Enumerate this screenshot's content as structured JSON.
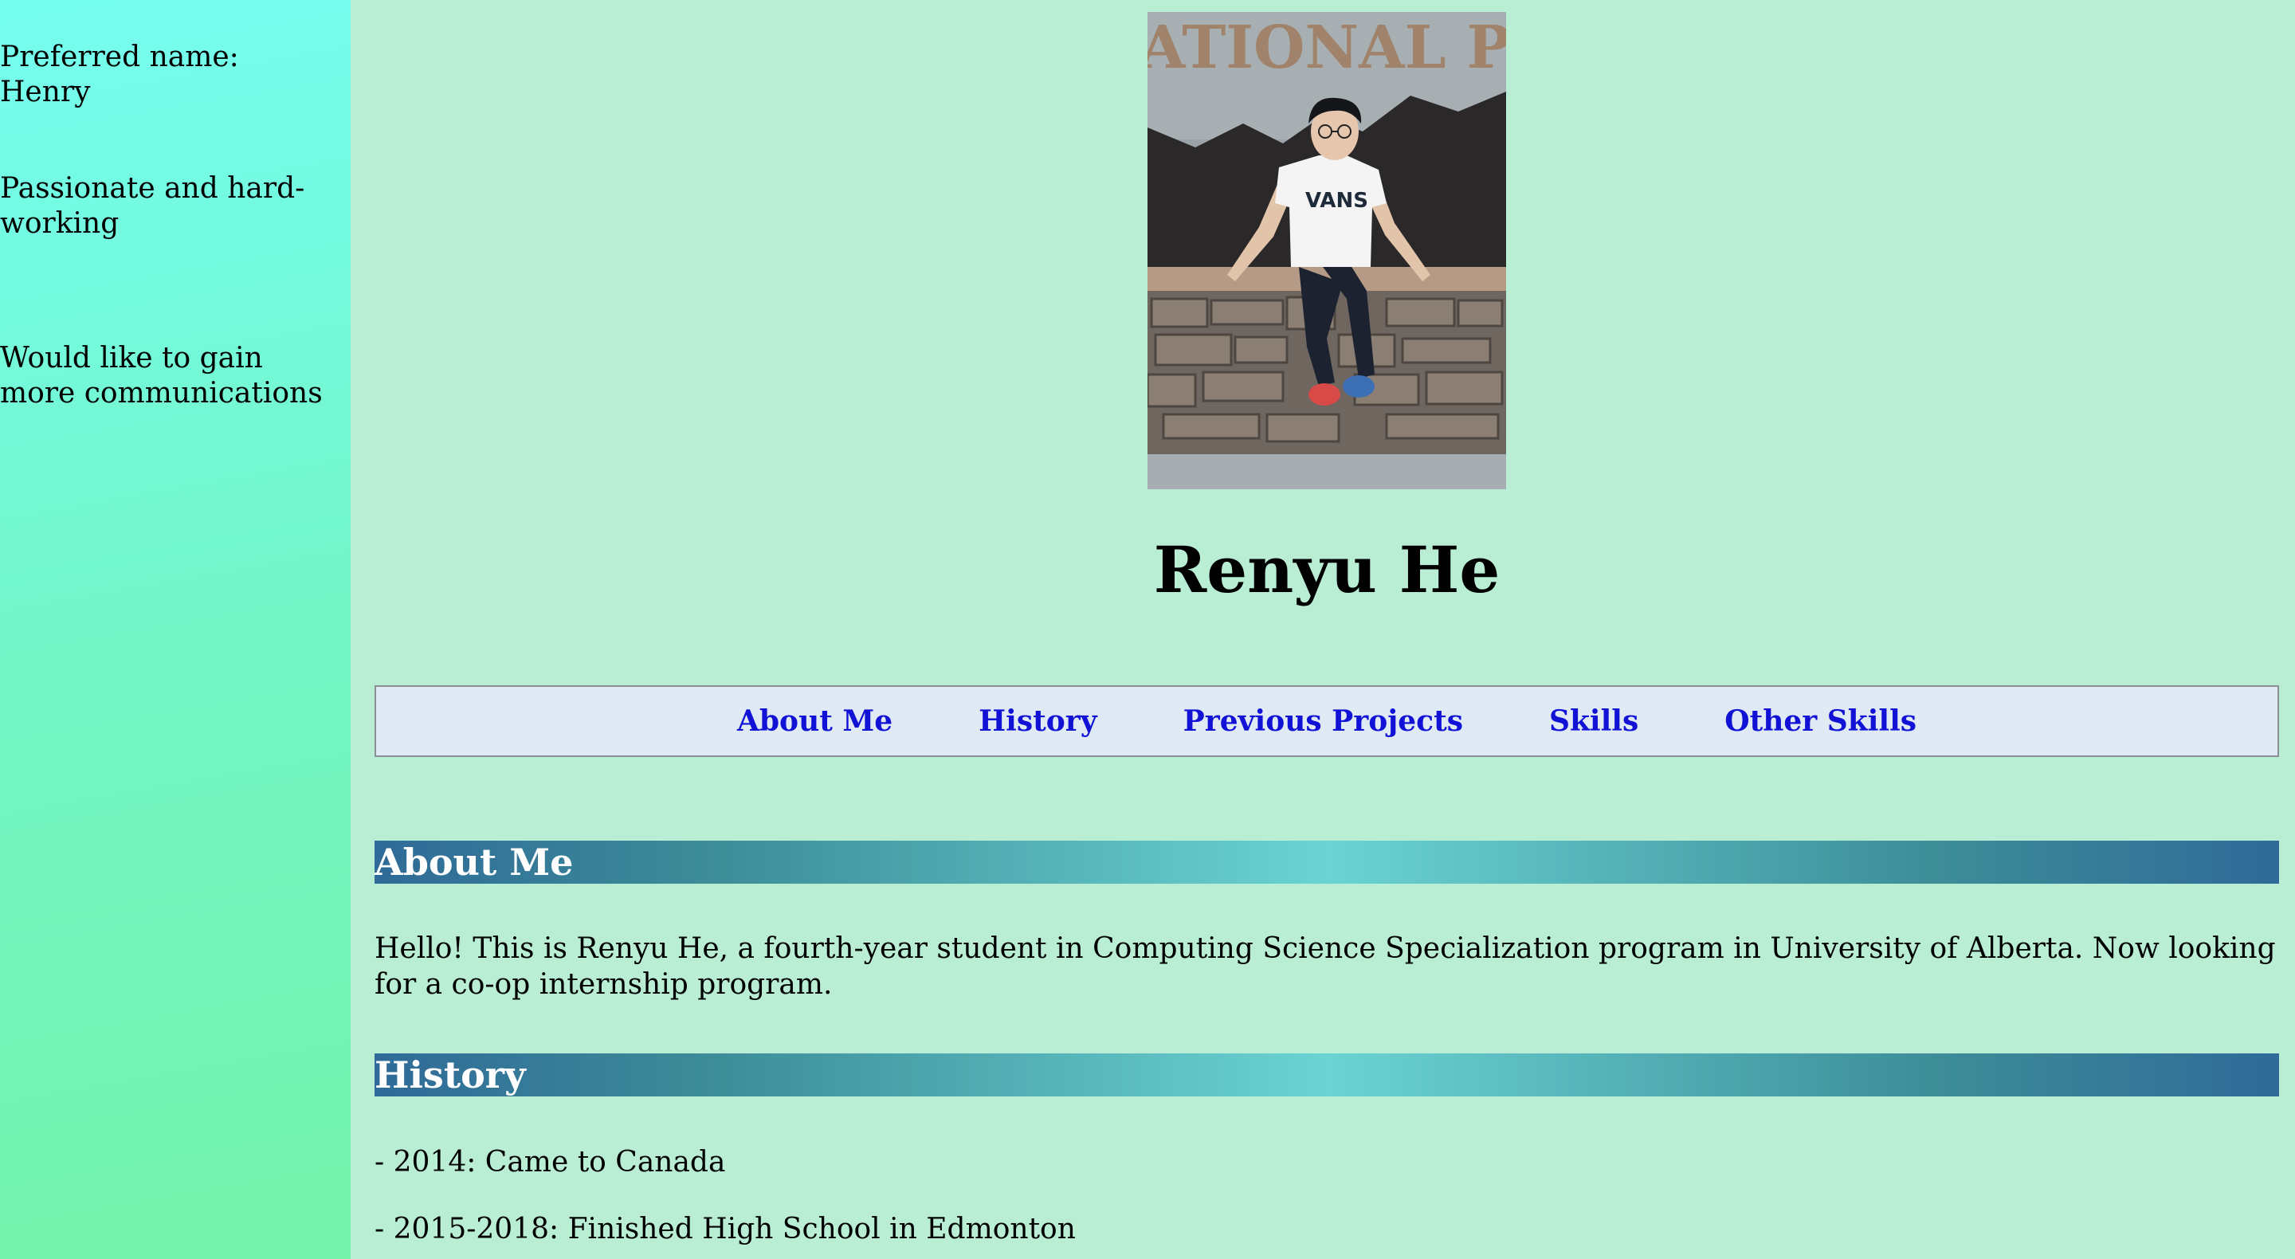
{
  "sidebar": {
    "items": [
      "Preferred name: Henry",
      "Passionate and hard-working",
      "Would like to gain more communications"
    ]
  },
  "profile": {
    "name": "Renyu He",
    "photo_sign_text": "ATIONAL PE",
    "shirt_logo": "VANS"
  },
  "nav": {
    "items": [
      "About Me",
      "History",
      "Previous Projects",
      "Skills",
      "Other Skills"
    ]
  },
  "about": {
    "heading": "About Me",
    "text": "Hello! This is Renyu He, a fourth-year student in Computing Science Specialization program in University of Alberta. Now looking for a co-op internship program."
  },
  "history": {
    "heading": "History",
    "items": [
      "- 2014: Came to Canada",
      "- 2015-2018: Finished High School in Edmonton"
    ]
  },
  "colors": {
    "sidebar_top": "#75fdf0",
    "sidebar_bottom": "#74f3ab",
    "page_background": "#b9eed4",
    "nav_background": "#dfeaf4",
    "link": "#1212d6",
    "heading_band_dark": "#2f6a98",
    "heading_band_light": "#6ad3d4"
  }
}
